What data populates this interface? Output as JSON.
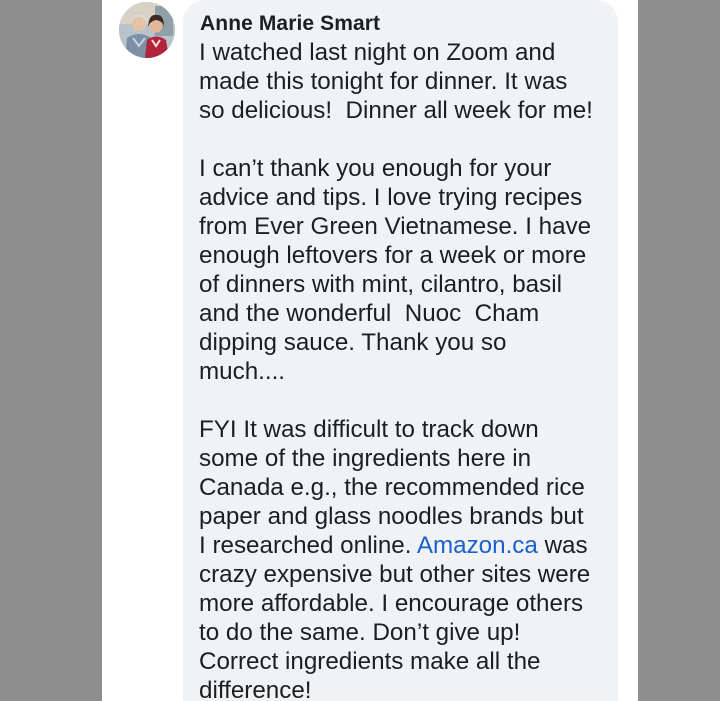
{
  "comment": {
    "author": "Anne Marie Smart",
    "paragraph1": [
      "I watched last night on Zoom and",
      "made this tonight for dinner. It was",
      "so delicious!  Dinner all week for me!"
    ],
    "paragraph2": [
      "I can’t thank you enough for your",
      "advice and tips. I love trying recipes",
      "from Ever Green Vietnamese. I have",
      "enough leftovers for a week or more",
      "of dinners with mint, cilantro, basil",
      "and the wonderful  Nuoc  Cham",
      "dipping sauce. Thank you so",
      "much...."
    ],
    "paragraph3": {
      "lines_before": [
        "FYI It was difficult to track down",
        "some of the ingredients here in",
        "Canada e.g., the recommended rice",
        "paper and glass noodles brands but"
      ],
      "link_line_prefix": "I researched online. ",
      "link_text": "Amazon.ca",
      "link_line_suffix": " was",
      "lines_after": [
        "crazy expensive but other sites were",
        "more affordable. I encourage others",
        "to do the same. Don’t give up!",
        "Correct ingredients make all the",
        "difference!"
      ]
    }
  },
  "colors": {
    "bubble": "#f0f2f5",
    "link": "#1a5fd0",
    "text": "#1c1e21",
    "side_background": "#8e8e8e"
  }
}
